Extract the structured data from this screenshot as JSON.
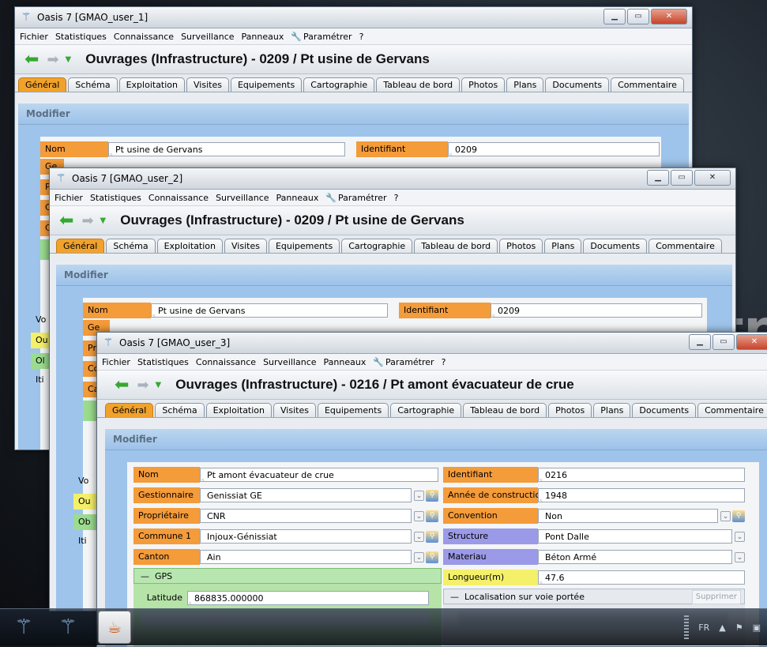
{
  "menu": [
    "Fichier",
    "Statistiques",
    "Connaissance",
    "Surveillance",
    "Panneaux",
    "Paramétrer",
    "?"
  ],
  "tabs": [
    "Général",
    "Schéma",
    "Exploitation",
    "Visites",
    "Equipements",
    "Cartographie",
    "Tableau de bord",
    "Photos",
    "Plans",
    "Documents",
    "Commentaire"
  ],
  "modifier": "Modifier",
  "win1": {
    "title": "Oasis 7 [GMAO_user_1]",
    "page_title": "Ouvrages (Infrastructure) - 0209 / Pt usine de Gervans",
    "nom_label": "Nom",
    "nom_value": "Pt usine de Gervans",
    "ident_label": "Identifiant",
    "ident_value": "0209",
    "partial_labels": [
      "Ge",
      "Pr",
      "Co",
      "Ca",
      "Vo",
      "Ou",
      "Ol",
      "Iti"
    ]
  },
  "win2": {
    "title": "Oasis 7 [GMAO_user_2]",
    "page_title": "Ouvrages (Infrastructure) - 0209 / Pt usine de Gervans",
    "nom_label": "Nom",
    "nom_value": "Pt usine de Gervans",
    "ident_label": "Identifiant",
    "ident_value": "0209",
    "partial_labels": [
      "Ge",
      "Pri",
      "Co",
      "Ca",
      "Vo",
      "Ou",
      "Ob",
      "Iti"
    ]
  },
  "win3": {
    "title": "Oasis 7 [GMAO_user_3]",
    "page_title": "Ouvrages (Infrastructure) - 0216 / Pt amont évacuateur de crue",
    "left": [
      {
        "label": "Nom",
        "value": "Pt amont évacuateur de crue"
      },
      {
        "label": "Gestionnaire",
        "value": "Genissiat GE"
      },
      {
        "label": "Propriétaire",
        "value": "CNR"
      },
      {
        "label": "Commune 1",
        "value": "Injoux-Génissiat"
      },
      {
        "label": "Canton",
        "value": "Ain"
      }
    ],
    "right": [
      {
        "label": "Identifiant",
        "value": "0216"
      },
      {
        "label": "Année de construction",
        "value": "1948"
      },
      {
        "label": "Convention",
        "value": "Non"
      },
      {
        "label": "Structure",
        "value": "Pont Dalle"
      },
      {
        "label": "Materiau",
        "value": "Béton Armé"
      },
      {
        "label": "Longueur(m)",
        "value": "47.6"
      }
    ],
    "gps_label": "GPS",
    "latitude_label": "Latitude",
    "latitude_value": "868835.000000",
    "loc_label": "Localisation sur voie portée",
    "supprimer": "Supprimer"
  },
  "taskbar": {
    "lang": "FR"
  }
}
